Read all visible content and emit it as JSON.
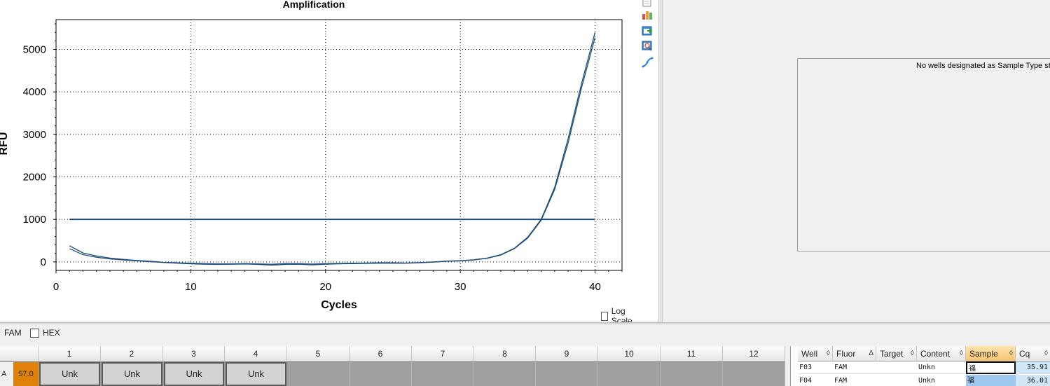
{
  "chart_data": {
    "type": "line",
    "title": "Amplification",
    "xlabel": "Cycles",
    "ylabel": "RFU",
    "xlim": [
      0,
      42
    ],
    "ylim": [
      -200,
      5700
    ],
    "xticks": [
      0,
      10,
      20,
      30,
      40
    ],
    "yticks": [
      0,
      1000,
      2000,
      3000,
      4000,
      5000
    ],
    "grid": true,
    "x": [
      1,
      2,
      3,
      4,
      5,
      6,
      7,
      8,
      9,
      10,
      11,
      12,
      13,
      14,
      15,
      16,
      17,
      18,
      19,
      20,
      21,
      22,
      23,
      24,
      25,
      26,
      27,
      28,
      29,
      30,
      31,
      32,
      33,
      34,
      35,
      36,
      37,
      38,
      39,
      40
    ],
    "series": [
      {
        "values": [
          380,
          210,
          140,
          90,
          60,
          35,
          15,
          -10,
          -20,
          -30,
          -40,
          -45,
          -45,
          -40,
          -45,
          -55,
          -40,
          -40,
          -50,
          -40,
          -35,
          -30,
          -25,
          -20,
          -20,
          -25,
          -15,
          0,
          20,
          30,
          50,
          90,
          170,
          320,
          580,
          1000,
          1750,
          2900,
          4200,
          5400
        ]
      },
      {
        "values": [
          310,
          170,
          110,
          70,
          45,
          25,
          5,
          -15,
          -30,
          -45,
          -55,
          -60,
          -55,
          -50,
          -60,
          -75,
          -60,
          -55,
          -70,
          -55,
          -45,
          -40,
          -35,
          -30,
          -30,
          -30,
          -20,
          -5,
          15,
          25,
          45,
          85,
          160,
          310,
          560,
          980,
          1700,
          2800,
          4100,
          5280
        ]
      }
    ],
    "threshold": {
      "x": [
        1,
        40
      ],
      "y": 1000
    },
    "line_color": "#1f4e79"
  },
  "chart_options": {
    "log_scale_label": "Log Scale",
    "log_scale_checked": false
  },
  "toolbar": {
    "icons": [
      "copy-icon",
      "chart-settings-icon",
      "export-icon",
      "zoom-icon",
      "curve-icon"
    ]
  },
  "standard_curve": {
    "message": "No wells designated as Sample Type sta"
  },
  "fluor_selector": {
    "selected": "FAM",
    "other": "HEX",
    "other_checked": false
  },
  "plate": {
    "columns": [
      "1",
      "2",
      "3",
      "4",
      "5",
      "6",
      "7",
      "8",
      "9",
      "10",
      "11",
      "12"
    ],
    "row_label": "A",
    "temperature": "57.0",
    "wells": [
      {
        "col": "1",
        "content": "Unk"
      },
      {
        "col": "2",
        "content": "Unk"
      },
      {
        "col": "3",
        "content": "Unk"
      },
      {
        "col": "4",
        "content": "Unk"
      }
    ]
  },
  "results_table": {
    "headers": [
      "Well",
      "Fluor",
      "Target",
      "Content",
      "Sample",
      "Cq"
    ],
    "sort_marks": [
      "◊",
      "Δ",
      "◊",
      "◊",
      "◊",
      "◊"
    ],
    "rows": [
      {
        "well": "F03",
        "fluor": "FAM",
        "target": "",
        "content": "Unkn",
        "sample": "福",
        "cq": "35.91"
      },
      {
        "well": "F04",
        "fluor": "FAM",
        "target": "",
        "content": "Unkn",
        "sample": "福",
        "cq": "36.01"
      }
    ]
  },
  "colors": {
    "accent": "#e0820a",
    "header_active": "#f7c46e",
    "cq_bg": "#cfe6f7"
  }
}
